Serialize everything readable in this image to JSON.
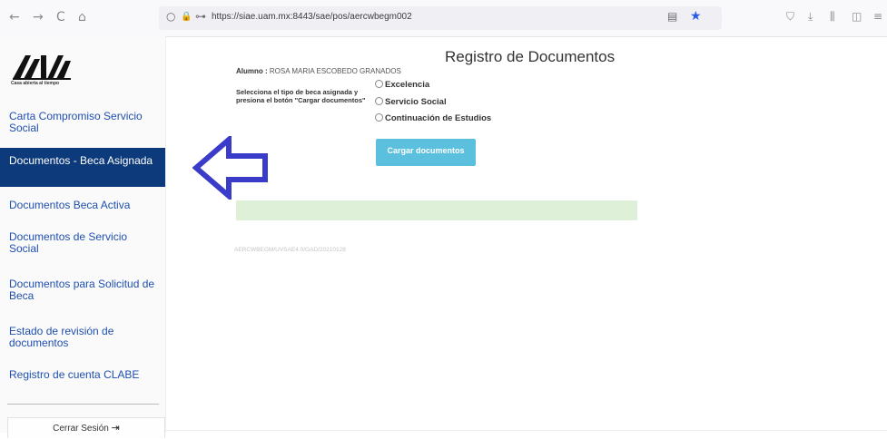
{
  "browser": {
    "back_icon": "←",
    "forward_icon": "→",
    "reload_icon": "C",
    "home_icon": "⌂",
    "url": "https://siae.uam.mx:8443/sae/pos/aercwbegm002",
    "shield_icon": "○",
    "lock_icon": "🔒",
    "key_icon": "⊶",
    "reader_icon": "▤",
    "bookmark_icon": "★",
    "toolbar_icons": [
      "⛉",
      "⤓",
      "⫼",
      "◫",
      "≡"
    ]
  },
  "sidebar": {
    "logo_caption": "Casa abierta al tiempo",
    "items": [
      {
        "label": "Carta Compromiso Servicio Social"
      },
      {
        "label": "Documentos - Beca Asignada"
      },
      {
        "label": "Documentos Beca Activa"
      },
      {
        "label": "Documentos de Servicio Social"
      },
      {
        "label": "Documentos para Solicitud de Beca"
      },
      {
        "label": "Estado de revisión de documentos"
      },
      {
        "label": "Registro de cuenta CLABE"
      }
    ],
    "active_index": 1,
    "logout_label": "Cerrar Sesión",
    "logout_icon": "⇥"
  },
  "main": {
    "title": "Registro de Documentos",
    "student_label": "Alumno :",
    "student_name": "ROSA MARIA ESCOBEDO GRANADOS",
    "instructions": "Selecciona el tipo de beca asignada y presiona el botón \"Cargar documentos\"",
    "options": [
      "Excelencia",
      "Servicio Social",
      "Continuación de Estudios"
    ],
    "upload_button": "Cargar documentos",
    "footer_code": "AERCWBEGM/UVSAE4.0/GAD/20210128"
  },
  "colors": {
    "accent": "#0d3a7a",
    "link": "#1f4fb0",
    "button": "#5bc0de",
    "alert": "#dff0d8",
    "arrow": "#3b3bc9"
  }
}
